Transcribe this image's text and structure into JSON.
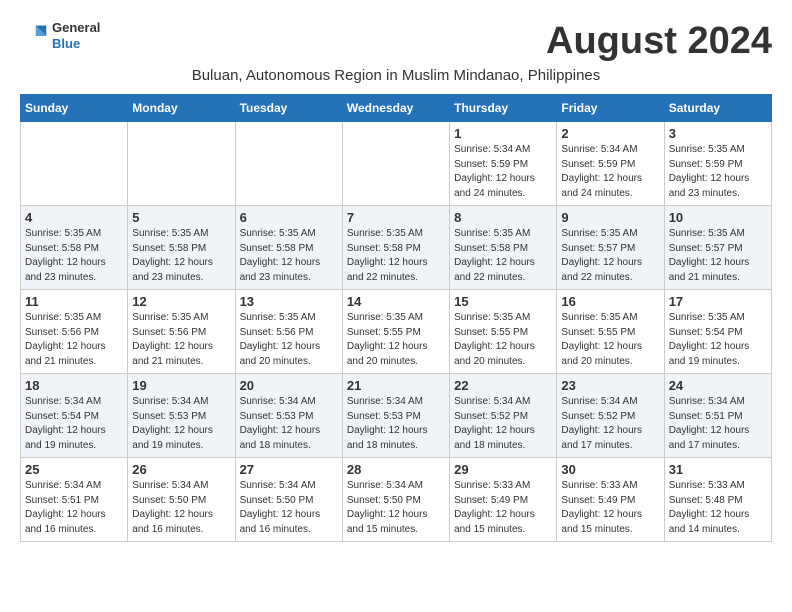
{
  "header": {
    "logo_line1": "General",
    "logo_line2": "Blue",
    "month_title": "August 2024",
    "subtitle": "Buluan, Autonomous Region in Muslim Mindanao, Philippines"
  },
  "days_of_week": [
    "Sunday",
    "Monday",
    "Tuesday",
    "Wednesday",
    "Thursday",
    "Friday",
    "Saturday"
  ],
  "weeks": [
    [
      {
        "day": "",
        "info": ""
      },
      {
        "day": "",
        "info": ""
      },
      {
        "day": "",
        "info": ""
      },
      {
        "day": "",
        "info": ""
      },
      {
        "day": "1",
        "info": "Sunrise: 5:34 AM\nSunset: 5:59 PM\nDaylight: 12 hours and 24 minutes."
      },
      {
        "day": "2",
        "info": "Sunrise: 5:34 AM\nSunset: 5:59 PM\nDaylight: 12 hours and 24 minutes."
      },
      {
        "day": "3",
        "info": "Sunrise: 5:35 AM\nSunset: 5:59 PM\nDaylight: 12 hours and 23 minutes."
      }
    ],
    [
      {
        "day": "4",
        "info": "Sunrise: 5:35 AM\nSunset: 5:58 PM\nDaylight: 12 hours and 23 minutes."
      },
      {
        "day": "5",
        "info": "Sunrise: 5:35 AM\nSunset: 5:58 PM\nDaylight: 12 hours and 23 minutes."
      },
      {
        "day": "6",
        "info": "Sunrise: 5:35 AM\nSunset: 5:58 PM\nDaylight: 12 hours and 23 minutes."
      },
      {
        "day": "7",
        "info": "Sunrise: 5:35 AM\nSunset: 5:58 PM\nDaylight: 12 hours and 22 minutes."
      },
      {
        "day": "8",
        "info": "Sunrise: 5:35 AM\nSunset: 5:58 PM\nDaylight: 12 hours and 22 minutes."
      },
      {
        "day": "9",
        "info": "Sunrise: 5:35 AM\nSunset: 5:57 PM\nDaylight: 12 hours and 22 minutes."
      },
      {
        "day": "10",
        "info": "Sunrise: 5:35 AM\nSunset: 5:57 PM\nDaylight: 12 hours and 21 minutes."
      }
    ],
    [
      {
        "day": "11",
        "info": "Sunrise: 5:35 AM\nSunset: 5:56 PM\nDaylight: 12 hours and 21 minutes."
      },
      {
        "day": "12",
        "info": "Sunrise: 5:35 AM\nSunset: 5:56 PM\nDaylight: 12 hours and 21 minutes."
      },
      {
        "day": "13",
        "info": "Sunrise: 5:35 AM\nSunset: 5:56 PM\nDaylight: 12 hours and 20 minutes."
      },
      {
        "day": "14",
        "info": "Sunrise: 5:35 AM\nSunset: 5:55 PM\nDaylight: 12 hours and 20 minutes."
      },
      {
        "day": "15",
        "info": "Sunrise: 5:35 AM\nSunset: 5:55 PM\nDaylight: 12 hours and 20 minutes."
      },
      {
        "day": "16",
        "info": "Sunrise: 5:35 AM\nSunset: 5:55 PM\nDaylight: 12 hours and 20 minutes."
      },
      {
        "day": "17",
        "info": "Sunrise: 5:35 AM\nSunset: 5:54 PM\nDaylight: 12 hours and 19 minutes."
      }
    ],
    [
      {
        "day": "18",
        "info": "Sunrise: 5:34 AM\nSunset: 5:54 PM\nDaylight: 12 hours and 19 minutes."
      },
      {
        "day": "19",
        "info": "Sunrise: 5:34 AM\nSunset: 5:53 PM\nDaylight: 12 hours and 19 minutes."
      },
      {
        "day": "20",
        "info": "Sunrise: 5:34 AM\nSunset: 5:53 PM\nDaylight: 12 hours and 18 minutes."
      },
      {
        "day": "21",
        "info": "Sunrise: 5:34 AM\nSunset: 5:53 PM\nDaylight: 12 hours and 18 minutes."
      },
      {
        "day": "22",
        "info": "Sunrise: 5:34 AM\nSunset: 5:52 PM\nDaylight: 12 hours and 18 minutes."
      },
      {
        "day": "23",
        "info": "Sunrise: 5:34 AM\nSunset: 5:52 PM\nDaylight: 12 hours and 17 minutes."
      },
      {
        "day": "24",
        "info": "Sunrise: 5:34 AM\nSunset: 5:51 PM\nDaylight: 12 hours and 17 minutes."
      }
    ],
    [
      {
        "day": "25",
        "info": "Sunrise: 5:34 AM\nSunset: 5:51 PM\nDaylight: 12 hours and 16 minutes."
      },
      {
        "day": "26",
        "info": "Sunrise: 5:34 AM\nSunset: 5:50 PM\nDaylight: 12 hours and 16 minutes."
      },
      {
        "day": "27",
        "info": "Sunrise: 5:34 AM\nSunset: 5:50 PM\nDaylight: 12 hours and 16 minutes."
      },
      {
        "day": "28",
        "info": "Sunrise: 5:34 AM\nSunset: 5:50 PM\nDaylight: 12 hours and 15 minutes."
      },
      {
        "day": "29",
        "info": "Sunrise: 5:33 AM\nSunset: 5:49 PM\nDaylight: 12 hours and 15 minutes."
      },
      {
        "day": "30",
        "info": "Sunrise: 5:33 AM\nSunset: 5:49 PM\nDaylight: 12 hours and 15 minutes."
      },
      {
        "day": "31",
        "info": "Sunrise: 5:33 AM\nSunset: 5:48 PM\nDaylight: 12 hours and 14 minutes."
      }
    ]
  ]
}
